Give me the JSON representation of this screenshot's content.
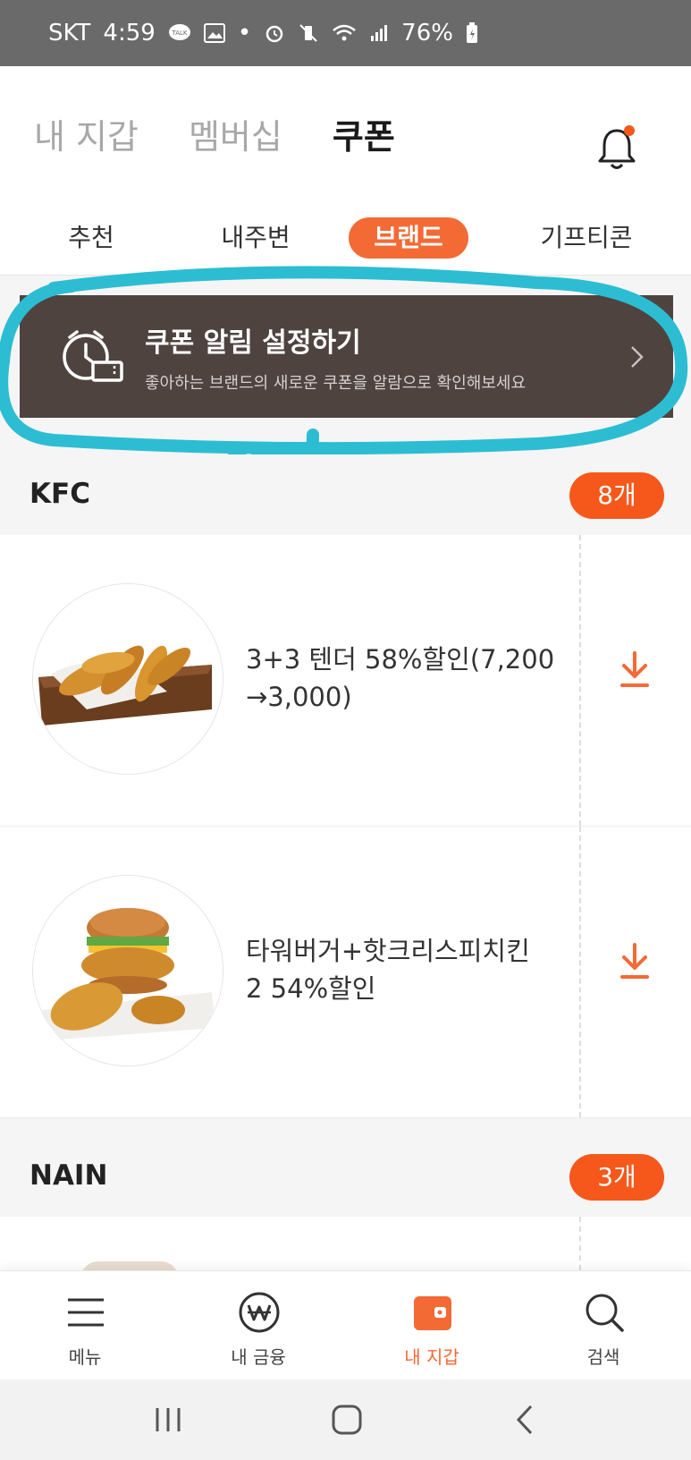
{
  "status_bar": {
    "carrier": "SKT",
    "time": "4:59",
    "talk_badge": "TALK",
    "battery": "76%"
  },
  "top_tabs": [
    {
      "label": "내 지갑",
      "active": false
    },
    {
      "label": "멤버십",
      "active": false
    },
    {
      "label": "쿠폰",
      "active": true
    }
  ],
  "sub_tabs": [
    {
      "label": "추천",
      "active": false
    },
    {
      "label": "내주변",
      "active": false
    },
    {
      "label": "브랜드",
      "active": true
    },
    {
      "label": "기프티콘",
      "active": false
    }
  ],
  "notice": {
    "title": "쿠폰 알림 설정하기",
    "subtitle": "좋아하는 브랜드의 새로운 쿠폰을 알람으로 확인해보세요"
  },
  "sections": [
    {
      "brand": "KFC",
      "count": "8개",
      "coupons": [
        {
          "title": "3+3 텐더 58%할인(7,200\n→3,000)",
          "line1": "3+3 텐더 58%할인(7,200",
          "line2": "→3,000)"
        },
        {
          "title": "타워버거+핫크리스피치킨 2 54%할인",
          "line1": "타워버거+핫크리스피치킨",
          "line2": "2 54%할인"
        }
      ]
    },
    {
      "brand": "NAIN",
      "count": "3개"
    }
  ],
  "bottom_nav": [
    {
      "label": "메뉴",
      "icon": "hamburger-menu-icon",
      "active": false
    },
    {
      "label": "내 금융",
      "icon": "won-circle-icon",
      "active": false
    },
    {
      "label": "내 지갑",
      "icon": "wallet-icon",
      "active": true
    },
    {
      "label": "검색",
      "icon": "search-icon",
      "active": false
    }
  ],
  "colors": {
    "accent": "#f36a35",
    "badge": "#f5581a",
    "banner": "#4f4340",
    "highlight_scribble": "#2dbdd3"
  }
}
